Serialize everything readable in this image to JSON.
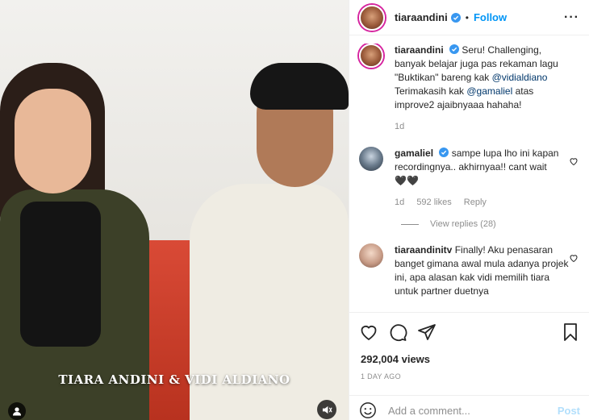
{
  "media": {
    "overlay_caption": "TIARA ANDINI & VIDI ALDIANO"
  },
  "header": {
    "username": "tiaraandini",
    "separator": "•",
    "follow_label": "Follow",
    "more_label": "···"
  },
  "caption": {
    "username": "tiaraandini",
    "text_1": "Seru! Challenging, banyak belajar juga pas rekaman lagu \"Buktikan\" bareng kak ",
    "mention_1": "@vidialdiano",
    "text_2": "Terimakasih kak ",
    "mention_2": "@gamaliel",
    "text_3": " atas improve2 ajaibnyaaa hahaha!",
    "time": "1d"
  },
  "comments": [
    {
      "username": "gamaliel",
      "text": "sampe lupa lho ini kapan recordingnya.. akhirnyaa!! cant wait",
      "emoji": "🖤🖤",
      "time": "1d",
      "likes": "592 likes",
      "reply_label": "Reply",
      "view_replies": "View replies (28)"
    },
    {
      "username": "tiaraandinitv",
      "text": "Finally! Aku penasaran banget gimana awal mula adanya projek ini, apa alasan kak vidi memilih tiara untuk partner duetnya"
    }
  ],
  "stats": {
    "views": "292,004 views",
    "time_ago": "1 DAY AGO"
  },
  "add_comment": {
    "placeholder": "Add a comment...",
    "post_label": "Post"
  },
  "colors": {
    "accent": "#0095f6",
    "link": "#00376b",
    "muted": "#8e8e8e",
    "post_disabled": "#b2dffc"
  }
}
